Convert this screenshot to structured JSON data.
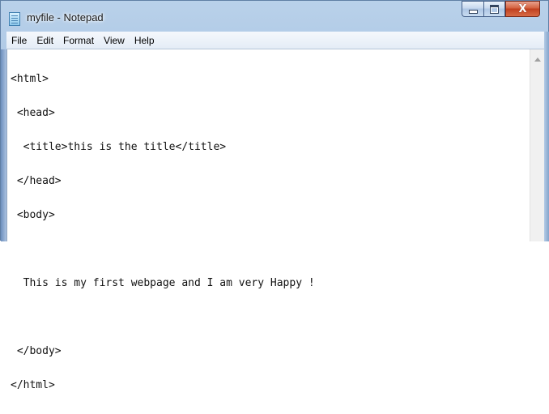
{
  "window": {
    "title": "myfile - Notepad",
    "close_glyph": "X"
  },
  "menu": [
    "File",
    "Edit",
    "Format",
    "View",
    "Help"
  ],
  "editor": {
    "lines": [
      "<html>",
      " <head>",
      "  <title>this is the title</title>",
      " </head>",
      " <body>",
      "",
      "  This is my first webpage and I am very Happy !",
      "",
      " </body>",
      "</html>"
    ]
  },
  "icons": {
    "app": "notepad-icon",
    "minimize": "minimize-icon",
    "maximize": "maximize-icon",
    "close": "close-icon",
    "scroll_up": "scroll-up-arrow-icon"
  },
  "colors": {
    "frame": "#a9c4e2",
    "close_button": "#c0401f",
    "editor_bg": "#ffffff"
  }
}
